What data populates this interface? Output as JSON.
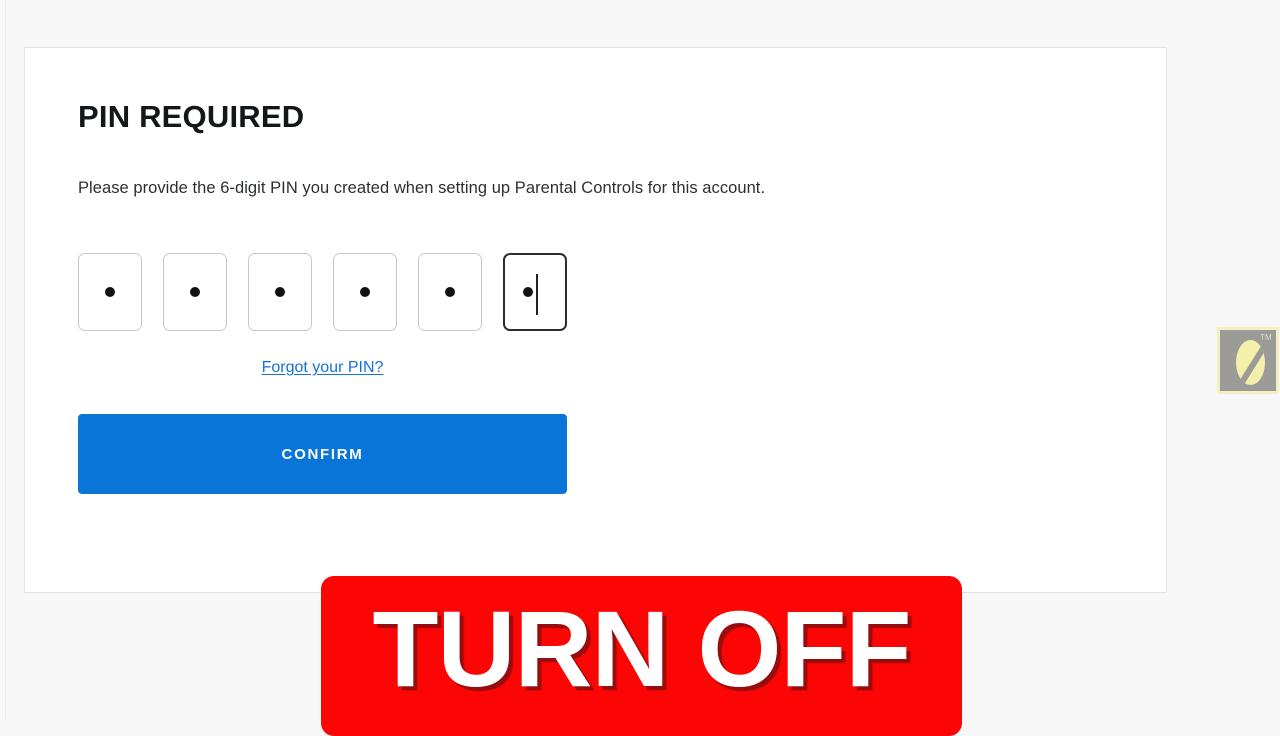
{
  "page": {
    "background_color": "#f7f7f7",
    "card_background": "#ffffff",
    "card_border_color": "#e3e3e3"
  },
  "card": {
    "title": "PIN REQUIRED",
    "instructions": "Please provide the 6-digit PIN you created when setting up Parental Controls for this account."
  },
  "pin_entry": {
    "digit_count": 6,
    "masked_character": "●",
    "boxes": [
      {
        "value": "●",
        "focused": false
      },
      {
        "value": "●",
        "focused": false
      },
      {
        "value": "●",
        "focused": false
      },
      {
        "value": "●",
        "focused": false
      },
      {
        "value": "●",
        "focused": false
      },
      {
        "value": "●",
        "focused": true
      }
    ],
    "focused_index": 5,
    "border_color": "#c8c8c8",
    "focused_border_color": "#2d2d2d"
  },
  "links": {
    "forgot_pin": "Forgot your PIN?",
    "forgot_pin_color": "#1471da"
  },
  "buttons": {
    "confirm_label": "CONFIRM",
    "confirm_color": "#0a75d9",
    "confirm_text_color": "#ffffff"
  },
  "overlay": {
    "banner_text": "TURN OFF",
    "banner_color": "#fb0505",
    "banner_text_color": "#ffffff"
  },
  "watermark": {
    "trademark_mark": "TM",
    "square_color": "#9b9b97",
    "accent_color": "#f4efab"
  }
}
